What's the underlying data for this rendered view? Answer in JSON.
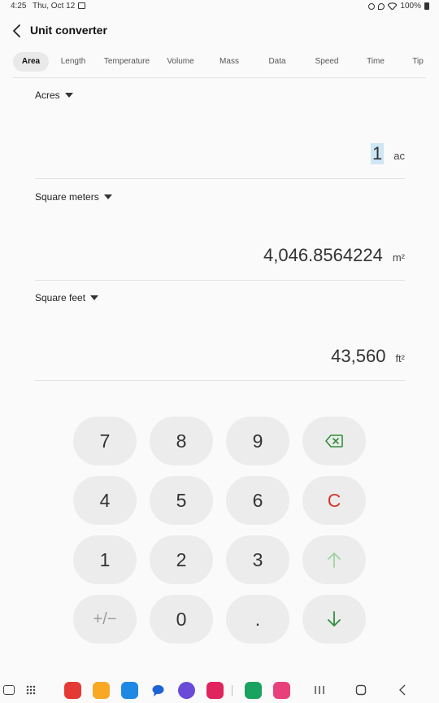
{
  "status": {
    "time": "4:25",
    "date": "Thu, Oct 12",
    "battery": "100%"
  },
  "header": {
    "title": "Unit converter"
  },
  "tabs": [
    {
      "label": "Area",
      "active": true
    },
    {
      "label": "Length"
    },
    {
      "label": "Temperature"
    },
    {
      "label": "Volume"
    },
    {
      "label": "Mass"
    },
    {
      "label": "Data"
    },
    {
      "label": "Speed"
    },
    {
      "label": "Time"
    },
    {
      "label": "Tip"
    }
  ],
  "units": [
    {
      "name": "Acres",
      "value": "1",
      "abbr": "ac",
      "editing": true
    },
    {
      "name": "Square meters",
      "value": "4,046.8564224",
      "abbr": "m²"
    },
    {
      "name": "Square feet",
      "value": "43,560",
      "abbr": "ft²"
    }
  ],
  "keypad": {
    "k7": "7",
    "k8": "8",
    "k9": "9",
    "k4": "4",
    "k5": "5",
    "k6": "6",
    "clear": "C",
    "k1": "1",
    "k2": "2",
    "k3": "3",
    "plus_minus": "+/−",
    "k0": "0",
    "dot": "."
  },
  "colors": {
    "clear": "#d23a2f",
    "arrow_down": "#2f8f3b",
    "arrow_up_disabled": "#9fd1a2",
    "edit_highlight": "#cfe6f5"
  },
  "icons": [
    "back-icon",
    "backspace-icon",
    "arrow-up-icon",
    "arrow-down-icon"
  ]
}
